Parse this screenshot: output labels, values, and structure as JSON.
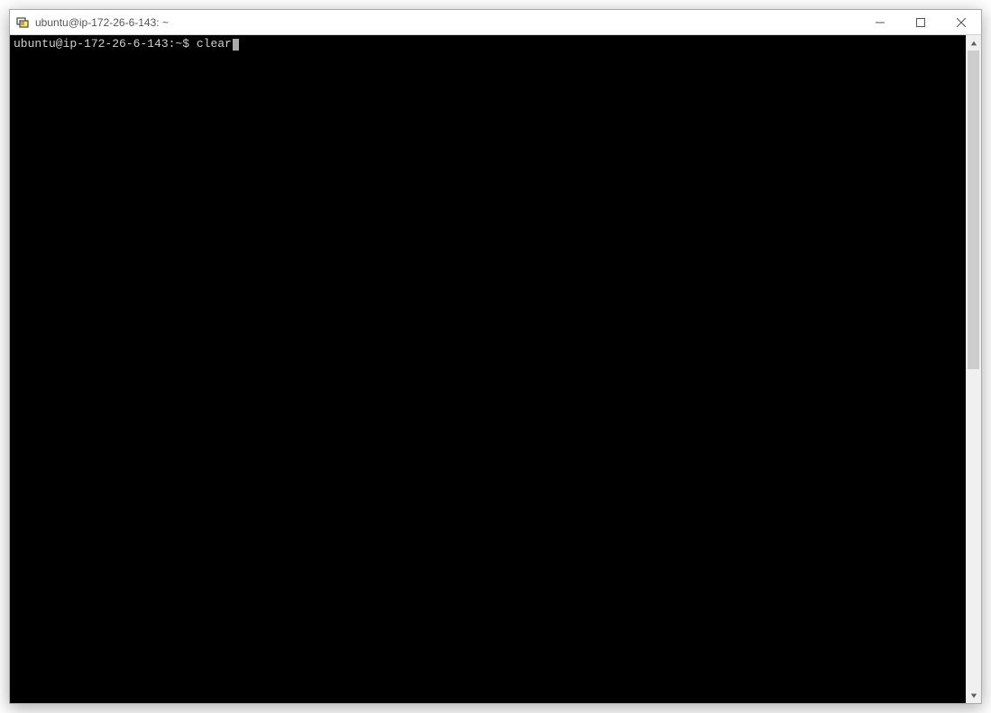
{
  "window": {
    "title": "ubuntu@ip-172-26-6-143: ~"
  },
  "terminal": {
    "prompt": "ubuntu@ip-172-26-6-143:~$ ",
    "command": "clear"
  }
}
